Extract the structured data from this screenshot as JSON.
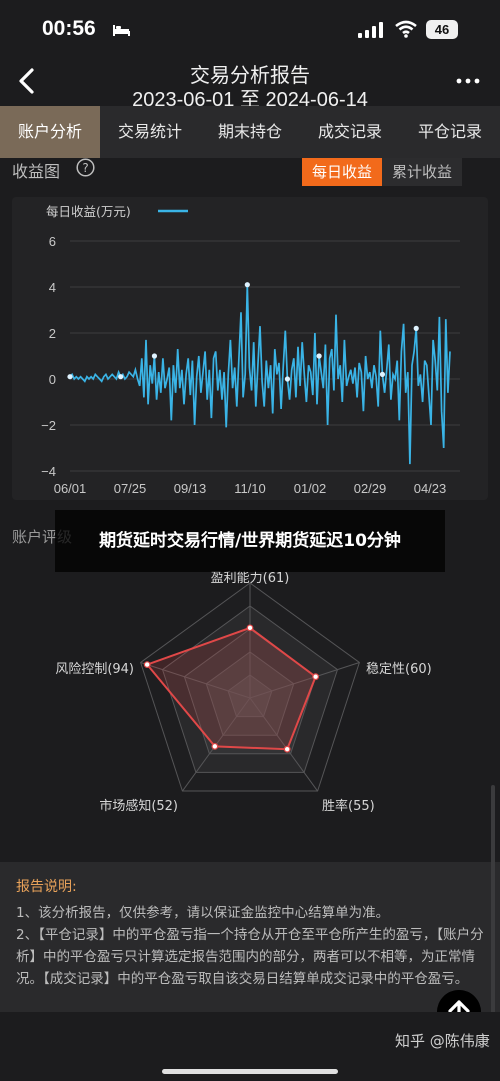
{
  "status_bar": {
    "time": "00:56",
    "battery": "46"
  },
  "header": {
    "title": "交易分析报告",
    "date_range": "2023-06-01 至 2024-06-14"
  },
  "tabs": [
    {
      "label": "账户分析",
      "active": true
    },
    {
      "label": "交易统计",
      "active": false
    },
    {
      "label": "期末持仓",
      "active": false
    },
    {
      "label": "成交记录",
      "active": false
    },
    {
      "label": "平仓记录",
      "active": false
    }
  ],
  "profit_card": {
    "title": "收益图",
    "segment": {
      "daily": "每日收益",
      "cumulative": "累计收益",
      "selected": "daily"
    }
  },
  "chart_data": {
    "type": "line",
    "legend": "每日收益(万元)",
    "series_color": "#3ab4e6",
    "ylim": [
      -4,
      6
    ],
    "yticks": [
      "6",
      "4",
      "2",
      "0",
      "−2",
      "−4"
    ],
    "x_ticks": [
      "06/01",
      "07/25",
      "09/13",
      "11/10",
      "01/02",
      "02/29",
      "04/23"
    ],
    "grid": "horizontal",
    "x_start": "2023-06-01",
    "x_end": "2024-06-14",
    "y": [
      0.1,
      0.2,
      0.0,
      0.1,
      0.0,
      0.1,
      0.0,
      -0.1,
      0.1,
      0.0,
      0.1,
      0.0,
      0.2,
      0.1,
      0.0,
      -0.1,
      0.1,
      0.2,
      0.0,
      0.1,
      0.2,
      0.1,
      0.0,
      0.3,
      0.1,
      0.2,
      0.0,
      0.1,
      0.3,
      0.2,
      0.1,
      0.4,
      0.0,
      -0.3,
      0.9,
      -0.8,
      1.7,
      -1.1,
      0.6,
      -0.2,
      1.0,
      -0.9,
      0.3,
      -0.6,
      0.9,
      -0.4,
      0.0,
      0.5,
      -1.8,
      0.6,
      -0.6,
      1.3,
      -0.4,
      0.4,
      -1.1,
      0.2,
      0.9,
      -0.7,
      0.8,
      -2.0,
      0.1,
      1.0,
      -0.6,
      0.3,
      1.2,
      -0.9,
      0.4,
      -1.7,
      0.9,
      1.2,
      -0.5,
      0.4,
      -0.9,
      0.3,
      -2.1,
      0.2,
      1.7,
      -0.4,
      0.5,
      -1.2,
      0.9,
      2.9,
      -0.8,
      0.2,
      4.1,
      0.5,
      -0.5,
      1.6,
      -1.2,
      0.6,
      2.3,
      -0.1,
      -1.2,
      0.8,
      -0.4,
      0.6,
      -1.5,
      1.3,
      0.2,
      0.7,
      -1.3,
      0.5,
      2.1,
      0.0,
      -0.9,
      0.4,
      0.9,
      -0.8,
      1.4,
      -0.3,
      1.6,
      0.2,
      -1.0,
      0.6,
      0.3,
      -0.7,
      2.0,
      -1.1,
      1.0,
      0.3,
      -0.4,
      1.5,
      -2.0,
      0.9,
      1.3,
      -0.5,
      2.8,
      0.0,
      0.6,
      -1.0,
      1.7,
      -0.3,
      0.1,
      0.4,
      -0.2,
      0.5,
      -0.8,
      0.7,
      0.3,
      -1.4,
      1.0,
      0.0,
      0.3,
      -0.4,
      0.6,
      0.1,
      -1.2,
      2.1,
      0.2,
      -0.6,
      0.4,
      1.5,
      -0.9,
      0.2,
      0.0,
      0.8,
      -1.8,
      1.2,
      2.4,
      -0.6,
      0.3,
      -3.7,
      0.6,
      1.2,
      2.2,
      -0.3,
      0.2,
      -1.0,
      0.8,
      0.6,
      -0.7,
      -2.0,
      1.7,
      0.8,
      -0.5,
      2.7,
      -1.4,
      -3.0,
      2.6,
      -0.6,
      1.2
    ]
  },
  "score_card": {
    "title": "账户评级"
  },
  "radar": {
    "color": "#e04848",
    "axes": [
      {
        "label": "盈利能力(61)",
        "value": 61
      },
      {
        "label": "稳定性(60)",
        "value": 60
      },
      {
        "label": "胜率(55)",
        "value": 55
      },
      {
        "label": "市场感知(52)",
        "value": 52
      },
      {
        "label": "风险控制(94)",
        "value": 94
      }
    ]
  },
  "overlay_banner": "期货延时交易行情/世界期货延迟10分钟",
  "notes": {
    "title": "报告说明:",
    "items": [
      "1、该分析报告，仅供参考，请以保证金监控中心结算单为准。",
      "2、【平仓记录】中的平仓盈亏指一个持仓从开仓至平仓所产生的盈亏，【账户分析】中的平仓盈亏只计算选定报告范围内的部分，两者可以不相等，为正常情况。【成交记录】中的平仓盈亏取自该交易日结算单成交记录中的平仓盈亏。"
    ]
  },
  "watermark": "知乎 @陈伟康"
}
